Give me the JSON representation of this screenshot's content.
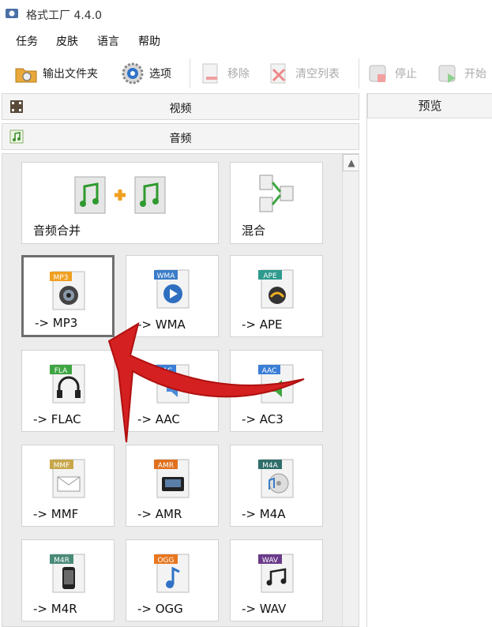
{
  "window": {
    "title": "格式工厂 4.4.0"
  },
  "menu": [
    "任务",
    "皮肤",
    "语言",
    "帮助"
  ],
  "toolbar": {
    "output_folder": "输出文件夹",
    "options": "选项",
    "remove": "移除",
    "clear_list": "清空列表",
    "stop": "停止",
    "start": "开始"
  },
  "categories": {
    "video": "视频",
    "audio": "音频"
  },
  "preview": {
    "title": "预览"
  },
  "tiles": {
    "merge": {
      "label": "音频合并"
    },
    "mix": {
      "label": "混合"
    },
    "mp3": {
      "label": "-> MP3",
      "badge": "MP3"
    },
    "wma": {
      "label": "-> WMA",
      "badge": "WMA"
    },
    "ape": {
      "label": "-> APE",
      "badge": "APE"
    },
    "flac": {
      "label": "-> FLAC",
      "badge": "FLA"
    },
    "aac": {
      "label": "-> AAC",
      "badge": "AAC"
    },
    "ac3": {
      "label": "-> AC3",
      "badge": "AAC"
    },
    "mmf": {
      "label": "-> MMF",
      "badge": "MMF"
    },
    "amr": {
      "label": "-> AMR",
      "badge": "AMR"
    },
    "m4a": {
      "label": "-> M4A",
      "badge": "M4A"
    },
    "m4r": {
      "label": "-> M4R",
      "badge": "M4R"
    },
    "ogg": {
      "label": "-> OGG",
      "badge": "OGG"
    },
    "wav": {
      "label": "-> WAV",
      "badge": "WAV"
    }
  },
  "colors": {
    "annotation_arrow": "#d42020",
    "badge_mp3": "#f0a020",
    "badge_wma": "#3a7cc8",
    "badge_ape": "#2f9a8e",
    "badge_flac": "#3fa542",
    "badge_aac": "#3b7ed6",
    "badge_mmf": "#c7a74a",
    "badge_amr": "#e0701e",
    "badge_m4a": "#2f6e6a",
    "badge_m4r": "#4a8a78",
    "badge_ogg": "#e8761e",
    "badge_wav": "#6a3a8a"
  }
}
